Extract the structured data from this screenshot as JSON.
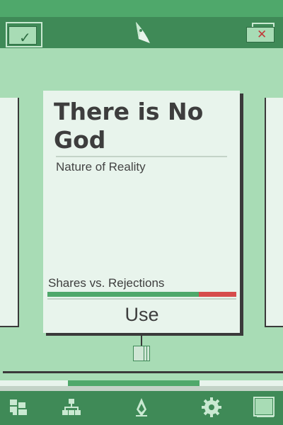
{
  "card": {
    "title": "There is No God",
    "category": "Nature of Reality",
    "ratio_label": "Shares vs. Rejections",
    "shares_fraction": 0.8,
    "use_label": "Use"
  },
  "progress": {
    "start_fraction": 0.24,
    "end_fraction": 0.705
  },
  "icons": {
    "accept": "check-icon",
    "logo": "app-logo",
    "reject": "close-icon",
    "deck": "deck-icon",
    "nav": [
      "collection-icon",
      "hierarchy-icon",
      "app-logo-icon",
      "gear-icon",
      "stack-icon"
    ]
  },
  "colors": {
    "accent": "#4fa86b",
    "accent_dark": "#3f8a57",
    "background": "#a8dcb5",
    "card": "#e8f4ec",
    "reject": "#d64c4c"
  }
}
